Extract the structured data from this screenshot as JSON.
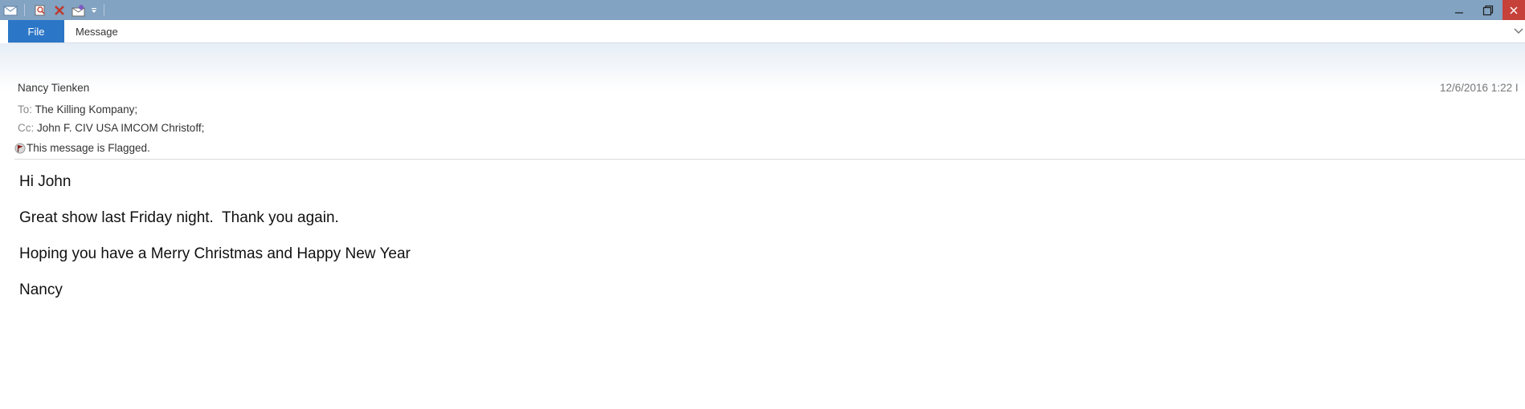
{
  "titlebar": {
    "quick_access_icons": [
      "envelope-icon",
      "search-message-icon",
      "delete-icon",
      "move-icon",
      "customize-dropdown-icon"
    ],
    "window_controls": [
      "minimize-icon",
      "restore-icon",
      "close-icon"
    ],
    "colors": {
      "bar": "#83a3c2",
      "close": "#c7413b"
    }
  },
  "ribbon": {
    "file_label": "File",
    "message_label": "Message",
    "file_color": "#2b76c7"
  },
  "header": {
    "sender": "Nancy Tienken",
    "date": "12/6/2016 1:22 I",
    "to_label": "To:",
    "to_value": "The Killing Kompany;",
    "cc_label": "Cc:",
    "cc_value": "John F. CIV USA IMCOM Christoff;",
    "flag_text": "This message is Flagged."
  },
  "body": {
    "lines": [
      "Hi John",
      "Great show last Friday night.  Thank you again.",
      "Hoping you have a Merry Christmas and Happy New Year",
      "Nancy"
    ]
  }
}
